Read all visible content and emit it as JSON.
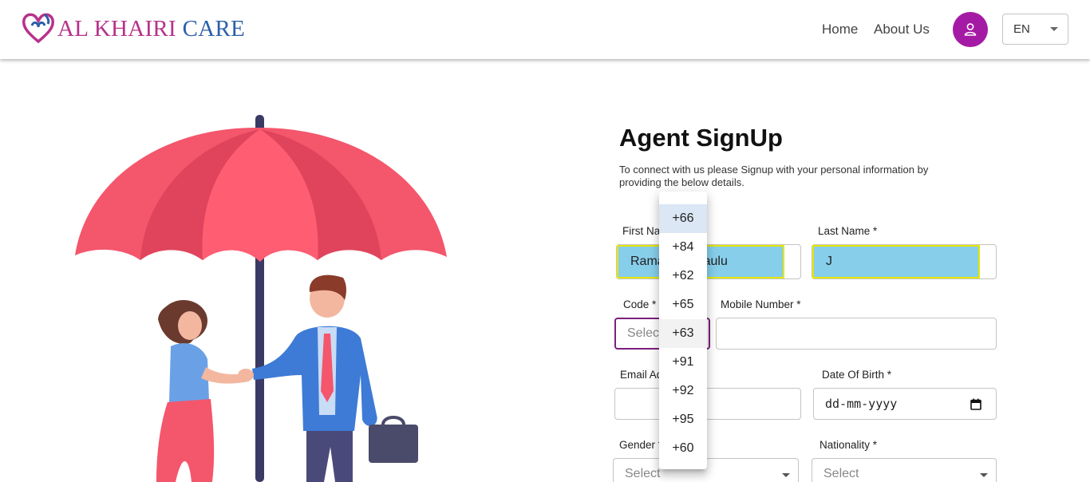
{
  "header": {
    "logo_part1": "AL KHAIRI",
    "logo_part2": "CARE",
    "nav": {
      "home": "Home",
      "about": "About Us"
    },
    "language": "EN"
  },
  "colors": {
    "brand_pink": "#b8318a",
    "brand_blue": "#2c5fa8",
    "avatar": "#a51aa4",
    "autofill": "#87ceeb"
  },
  "form": {
    "title": "Agent SignUp",
    "subtitle": "To connect with us please Signup with your personal information by providing the below details.",
    "first_name": {
      "label": "First Name *",
      "value": "Ramachandraulu"
    },
    "last_name": {
      "label": "Last Name *",
      "value": "J"
    },
    "code": {
      "label": "Code *",
      "placeholder": "Select"
    },
    "mobile": {
      "label": "Mobile Number *",
      "value": ""
    },
    "email": {
      "label": "Email Address *",
      "value": ""
    },
    "dob": {
      "label": "Date Of Birth *",
      "placeholder": "dd-mm-yyyy"
    },
    "gender": {
      "label": "Gender *",
      "placeholder": "Select"
    },
    "nationality": {
      "label": "Nationality *",
      "placeholder": "Select"
    }
  },
  "code_dropdown": {
    "options": [
      "+66",
      "+84",
      "+62",
      "+65",
      "+63",
      "+91",
      "+92",
      "+95",
      "+60"
    ],
    "selected_index": 0,
    "hover_index": 4
  },
  "icons": [
    "heart-hands-logo-icon",
    "user-icon",
    "chevron-down-icon",
    "calendar-icon"
  ]
}
